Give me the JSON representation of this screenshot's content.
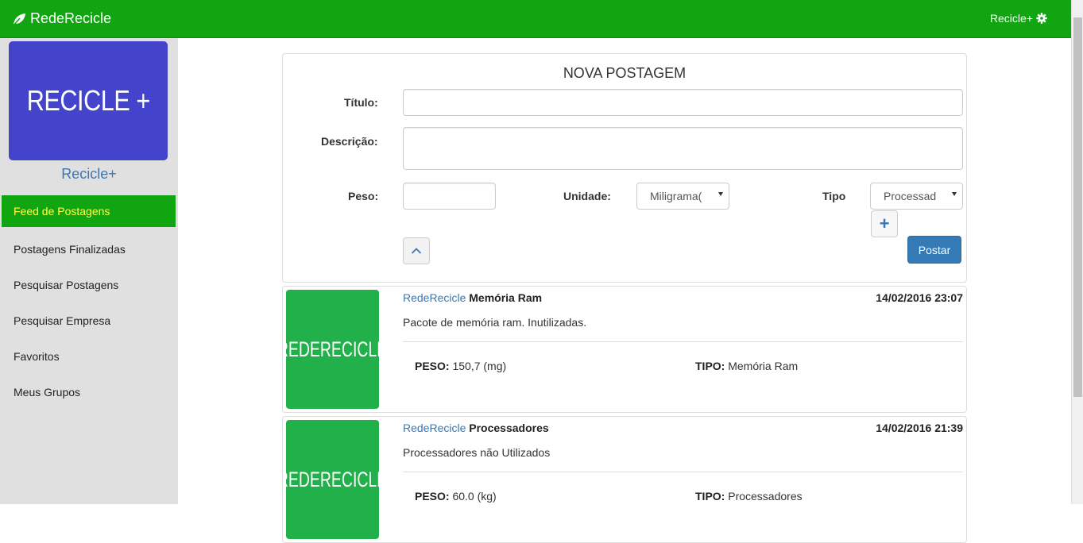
{
  "navbar": {
    "brand": "RedeRecicle",
    "user_menu": "Recicle+",
    "brand_icon": "leaf-icon",
    "menu_icon": "gear-icon",
    "color": "#12a512"
  },
  "sidebar": {
    "logo_text": "RECICLE +",
    "profile_name": "Recicle+",
    "items": [
      {
        "label": "Feed de Postagens",
        "active": true
      },
      {
        "label": "Postagens Finalizadas"
      },
      {
        "label": "Pesquisar Postagens"
      },
      {
        "label": "Pesquisar Empresa"
      },
      {
        "label": "Favoritos"
      },
      {
        "label": "Meus Grupos"
      }
    ]
  },
  "form": {
    "heading": "NOVA POSTAGEM",
    "titulo_label": "Título:",
    "titulo_value": "",
    "descricao_label": "Descrição:",
    "descricao_value": "",
    "peso_label": "Peso:",
    "peso_value": "",
    "unidade_label": "Unidade:",
    "unidade_selected": "Miligrama(",
    "tipo_label": "Tipo",
    "tipo_selected": "Processad",
    "add_label": "+",
    "post_button": "Postar"
  },
  "posts": [
    {
      "author": "RedeRecicle",
      "title": "Memória Ram",
      "date": "14/02/2016 23:07",
      "thumbnail_text": "REDERECICLE",
      "description": "Pacote de memória ram. Inutilizadas.",
      "peso_label": "PESO:",
      "peso": "150,7 (mg)",
      "tipo_label": "TIPO:",
      "tipo": "Memória Ram"
    },
    {
      "author": "RedeRecicle",
      "title": "Processadores",
      "date": "14/02/2016 21:39",
      "thumbnail_text": "REDERECICLE",
      "description": "Processadores não Utilizados",
      "peso_label": "PESO:",
      "peso": "60.0 (kg)",
      "tipo_label": "TIPO:",
      "tipo": "Processadores"
    }
  ]
}
